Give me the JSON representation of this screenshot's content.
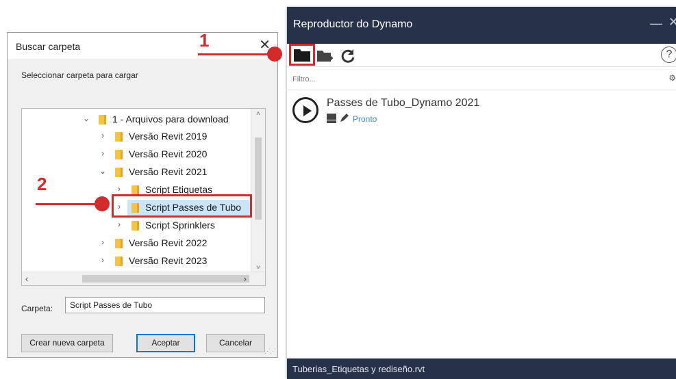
{
  "dialog": {
    "title": "Buscar carpeta",
    "close_glyph": "✕",
    "prompt": "Seleccionar carpeta para cargar",
    "tree": [
      {
        "label": "1 - Arquivos para download",
        "expanded": true
      },
      {
        "label": "Versão Revit 2019",
        "expanded": false
      },
      {
        "label": "Versão Revit 2020",
        "expanded": false
      },
      {
        "label": "Versão Revit 2021",
        "expanded": true
      },
      {
        "label": "Script Etiquetas",
        "expanded": false
      },
      {
        "label": "Script Passes de Tubo",
        "expanded": false,
        "selected": true
      },
      {
        "label": "Script Sprinklers",
        "expanded": false
      },
      {
        "label": "Versão Revit 2022",
        "expanded": false
      },
      {
        "label": "Versão Revit 2023",
        "expanded": false
      }
    ],
    "folder_label": "Carpeta:",
    "folder_value": "Script Passes de Tubo",
    "buttons": {
      "new_folder": "Crear nueva carpeta",
      "accept": "Aceptar",
      "cancel": "Cancelar"
    }
  },
  "player": {
    "title": "Reproductor do Dynamo",
    "minimize_glyph": "—",
    "close_glyph": "✕",
    "help_glyph": "?",
    "filter_placeholder": "Filtro...",
    "scripts": [
      {
        "name": "Passes de Tubo_Dynamo 2021",
        "status": "Pronto"
      }
    ],
    "footer": "Tuberias_Etiquetas y rediseño.rvt",
    "icons": [
      "folder-open-icon",
      "export-icon",
      "refresh-icon",
      "help-icon",
      "settings-icon",
      "play-icon",
      "revit-icon",
      "edit-icon"
    ]
  },
  "annotations": {
    "step1": "1",
    "step2": "2",
    "accent": "#d42a2a"
  },
  "colors": {
    "player_header": "#263249",
    "selection": "#cce4f7",
    "status_link": "#3f87c9"
  }
}
